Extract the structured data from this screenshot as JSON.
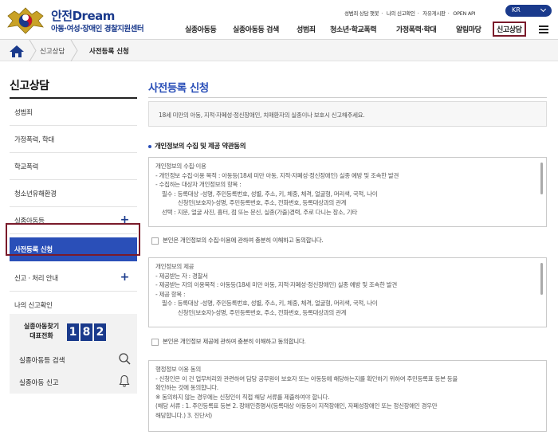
{
  "header": {
    "logo_title": "안전",
    "logo_title_dream": "Dream",
    "logo_subtitle": "아동·여성·장애인 경찰지원센터",
    "util_links": [
      "성범죄 상담 챗봇",
      "나의 신고확인",
      "자유게시판",
      "OPEN API"
    ],
    "util_seps": [
      "·",
      "·",
      "·"
    ],
    "lang": "KR",
    "nav": [
      "실종아동등",
      "실종아동등 검색",
      "성범죄",
      "청소년·학교폭력",
      "가정폭력·학대",
      "알림마당",
      "신고상담"
    ]
  },
  "breadcrumb": {
    "item1": "신고상담",
    "item2": "사전등록 신청"
  },
  "sidebar": {
    "title": "신고상담",
    "items": [
      {
        "label": "성범죄"
      },
      {
        "label": "가정폭력, 학대"
      },
      {
        "label": "학교폭력"
      },
      {
        "label": "청소년유해환경"
      },
      {
        "label": "실종아동등",
        "plus": "+"
      },
      {
        "label": "사전등록 신청"
      },
      {
        "label": "신고 · 처리 안내",
        "plus": "+"
      },
      {
        "label": "나의 신고확인"
      }
    ],
    "call": {
      "label_line1": "실종아동찾기",
      "label_line2": "대표전화",
      "digits": [
        "1",
        "8",
        "2"
      ],
      "search_label": "실종아동등 검색",
      "report_label": "실종아동 신고"
    }
  },
  "main": {
    "title": "사전등록 신청",
    "notice": "18세 미만의 아동, 지적·자폐성·정신장애인, 치매환자의 실종이나 보호시 신고해주세요.",
    "section_title": "개인정보의 수집 및 제공 약관동의",
    "terms1": [
      "개인정보의 수집·이용",
      "- 개인정보 수집·이용 목적 : 아동등(18세 미만 아동, 지적·자폐성·정신장애인) 실종 예방 및 조속한 발견",
      "- 수집하는 대상자 개인정보의 항목 :",
      "  필수 : 등록대상 -성명, 주민등록번호, 성별, 주소, 키, 체중, 체격, 얼굴형, 머리색, 국적, 나이",
      "          신청인(보호자)-성명, 주민등록번호, 주소, 전화번호, 등록대상과의 관계",
      "  선택 : 지문, 얼굴 사진, 흉터, 점 또는 문신, 실종(가출)경력, 주로 다니는 장소, 기타"
    ],
    "agree1": "본인은 개인정보의 수집·이용에 관하여 충분히 이해하고 동의합니다.",
    "terms2": [
      "개인정보의 제공",
      "- 제공받는 자 : 경찰서",
      "- 제공받는 자의 이용목적 : 아동등(18세 미만 아동, 지적·자폐성·정신장애인) 실종 예방 및 조속한 발견",
      "- 제공 항목 :",
      "  필수 : 등록대상 -성명, 주민등록번호, 성별, 주소, 키, 체중, 체격, 얼굴형, 머리색, 국적, 나이",
      "          신청인(보호자)-성명, 주민등록번호, 주소, 전화번호, 등록대상과의 관계"
    ],
    "agree2": "본인은 개인정보 제공에 관하여 충분히 이해하고 동의합니다.",
    "terms3": [
      "행정정보 이용 동의",
      "- 신청인은 이 건 업무처리와 관련하여 담당 공무원이 보호자 또는 아동등에 해당하는지를 확인하기 위하여 주민등록표 등본 등을",
      "확인하는 것에 동의합니다.",
      "※ 동의하지 않는 경우에는 신청인이 직접 해당 서류를 제출하여야 합니다.",
      "(해당 서류 : 1. 주민등록표 등본 2. 장애인증명서(등록대상 아동등이 지적장애인, 자폐성장애인 또는 정신장애인 경우만",
      "해당합니다.) 3. 진단서)"
    ]
  }
}
